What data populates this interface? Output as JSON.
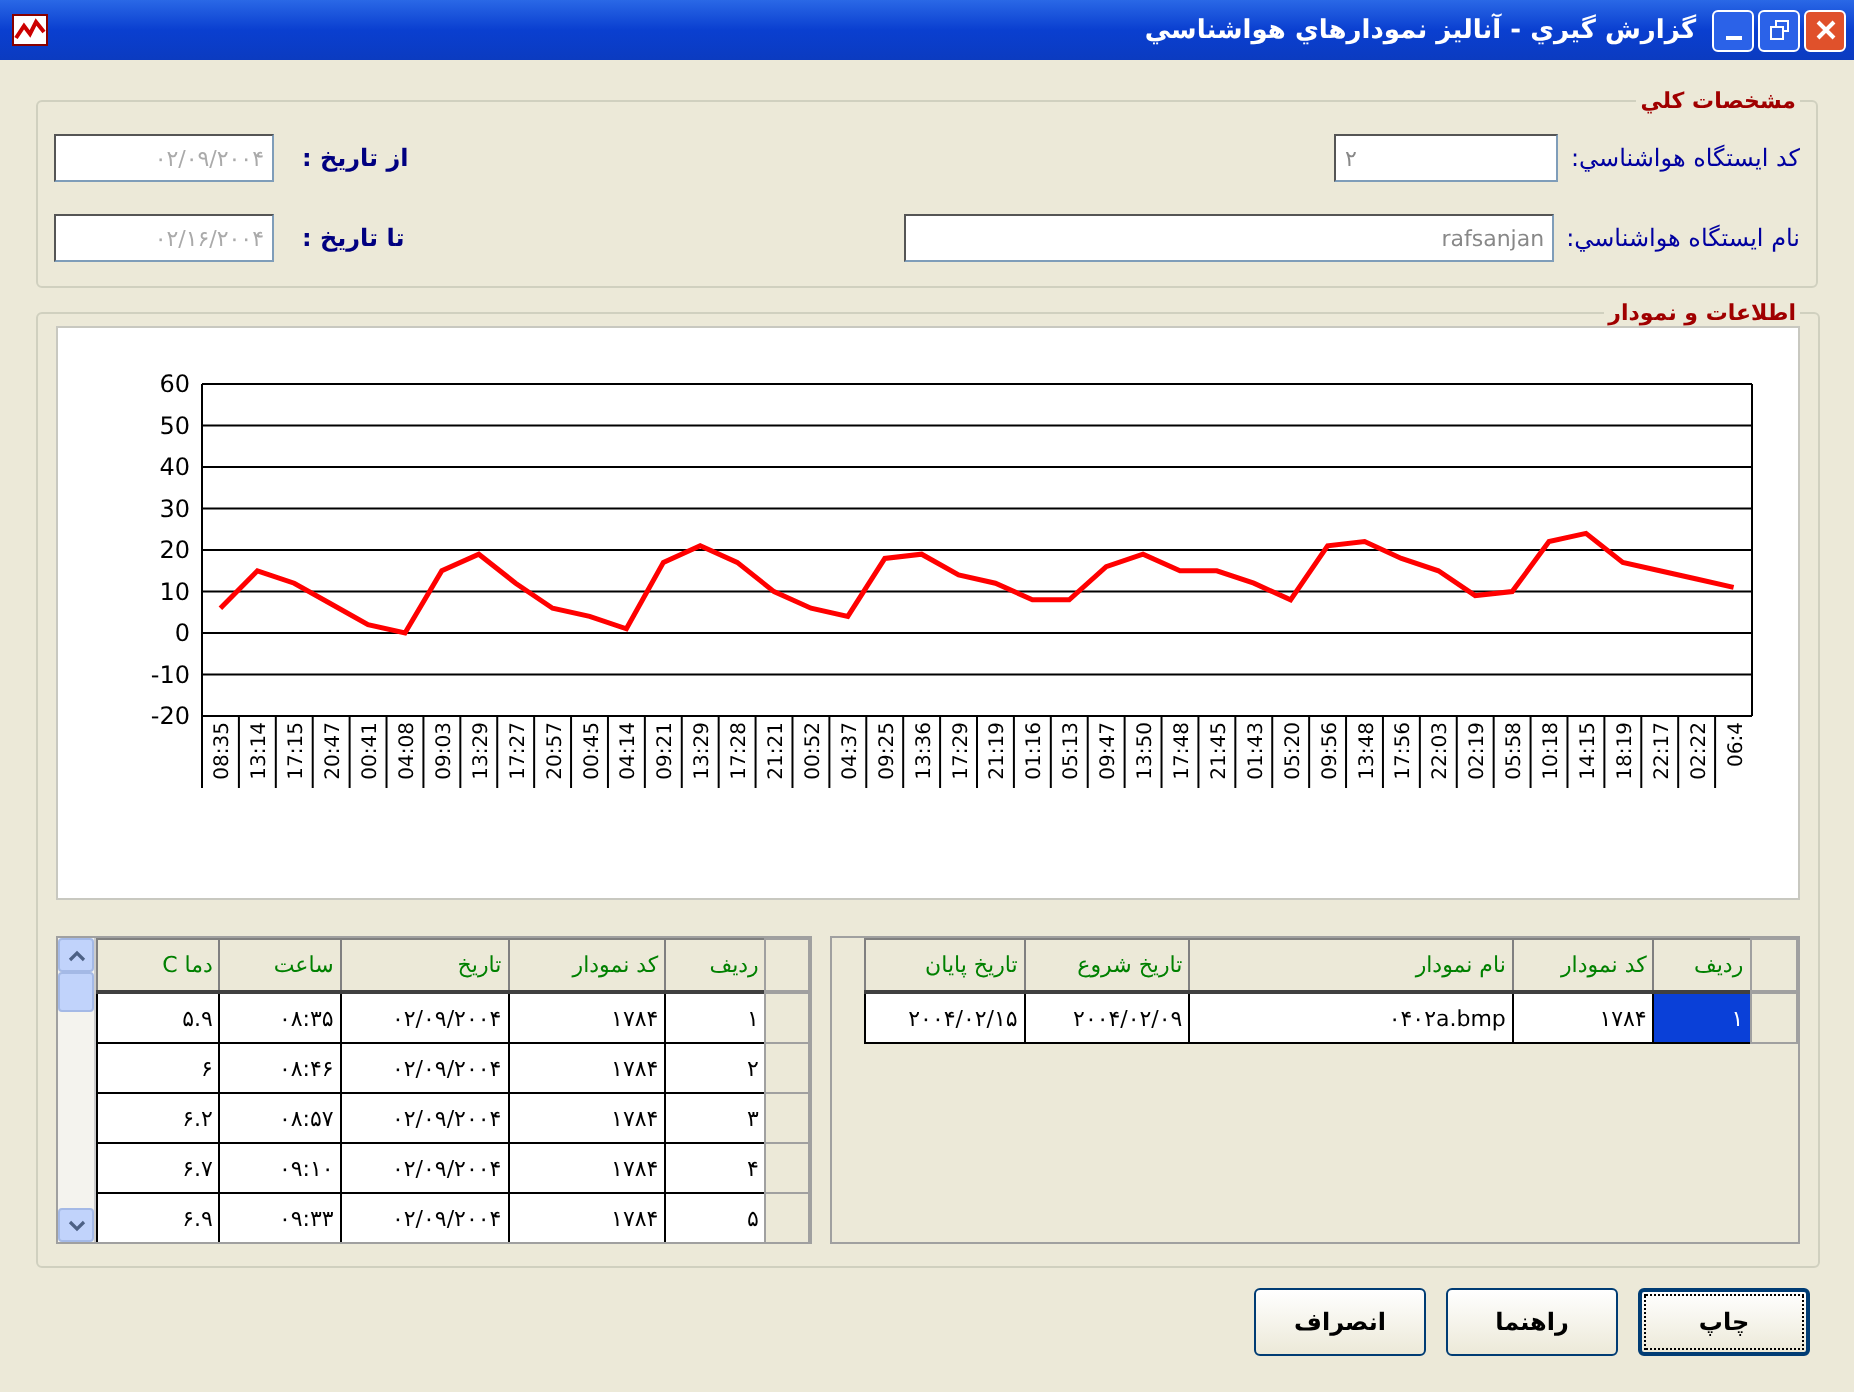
{
  "window": {
    "title": "گزارش گیري  -  آناليز نمودارهاي هواشناسي"
  },
  "general": {
    "legend": "مشخصات کلي",
    "station_code": {
      "label": "کد ایستگاه هواشناسي:",
      "value": "۲"
    },
    "station_name": {
      "label": "نام ایستگاه هواشناسي:",
      "value": "rafsanjan"
    },
    "from_date": {
      "label": "از تاریخ :",
      "value": "۰۲/۰۹/۲۰۰۴"
    },
    "to_date": {
      "label": "تا تاریخ :",
      "value": "۰۲/۱۶/۲۰۰۴"
    }
  },
  "data_group": {
    "legend": "اطلاعات و نمودار",
    "chart_data": {
      "type": "line",
      "categories": [
        "08:35",
        "13:14",
        "17:15",
        "20:47",
        "00:41",
        "04:08",
        "09:03",
        "13:29",
        "17:27",
        "20:57",
        "00:45",
        "04:14",
        "09:21",
        "13:29",
        "17:28",
        "21:21",
        "00:52",
        "04:37",
        "09:25",
        "13:36",
        "17:29",
        "21:19",
        "01:16",
        "05:13",
        "09:47",
        "13:50",
        "17:48",
        "21:45",
        "01:43",
        "05:20",
        "09:56",
        "13:48",
        "17:56",
        "22:03",
        "02:19",
        "05:58",
        "10:18",
        "14:15",
        "18:19",
        "22:17",
        "02:22",
        "06:4"
      ],
      "grid": true,
      "series": [
        {
          "color": "#ff0000",
          "values": [
            6,
            15,
            12,
            7,
            2,
            0,
            15,
            19,
            12,
            6,
            4,
            1,
            17,
            21,
            17,
            10,
            6,
            4,
            18,
            19,
            14,
            12,
            8,
            8,
            16,
            19,
            15,
            15,
            12,
            8,
            21,
            22,
            18,
            15,
            9,
            10,
            22,
            24,
            17,
            15,
            13,
            11
          ]
        }
      ],
      "ylim": [
        -20,
        60
      ],
      "yticks": [
        -20,
        -10,
        0,
        10,
        20,
        30,
        40,
        50,
        60
      ]
    }
  },
  "readings_table": {
    "columns": [
      "ردیف",
      "کد نمودار",
      "تاریخ",
      "ساعت",
      "دما C"
    ],
    "rows": [
      {
        "cells": [
          "۱",
          "۱۷۸۴",
          "۰۲/۰۹/۲۰۰۴",
          "۰۸:۳۵",
          "۵.۹"
        ],
        "selected": false
      },
      {
        "cells": [
          "۲",
          "۱۷۸۴",
          "۰۲/۰۹/۲۰۰۴",
          "۰۸:۴۶",
          "۶"
        ],
        "selected": false
      },
      {
        "cells": [
          "۳",
          "۱۷۸۴",
          "۰۲/۰۹/۲۰۰۴",
          "۰۸:۵۷",
          "۶.۲"
        ],
        "selected": false
      },
      {
        "cells": [
          "۴",
          "۱۷۸۴",
          "۰۲/۰۹/۲۰۰۴",
          "۰۹:۱۰",
          "۶.۷"
        ],
        "selected": false
      },
      {
        "cells": [
          "۵",
          "۱۷۸۴",
          "۰۲/۰۹/۲۰۰۴",
          "۰۹:۳۳",
          "۶.۹"
        ],
        "selected": false
      }
    ]
  },
  "charts_table": {
    "columns": [
      "ردیف",
      "کد نمودار",
      "نام نمودار",
      "تاریخ شروع",
      "تاریخ پایان"
    ],
    "rows": [
      {
        "cells": [
          "۱",
          "۱۷۸۴",
          "۰۴۰۲a.bmp",
          "۲۰۰۴/۰۲/۰۹",
          "۲۰۰۴/۰۲/۱۵"
        ],
        "selected": true
      }
    ]
  },
  "buttons": [
    {
      "label": "چاپ",
      "default": true
    },
    {
      "label": "راهنما",
      "default": false
    },
    {
      "label": "انصراف",
      "default": false
    }
  ]
}
